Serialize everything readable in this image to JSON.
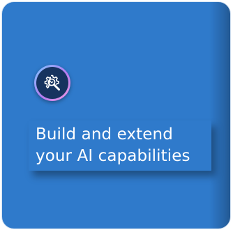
{
  "card": {
    "icon": "gear-wrench-search-icon",
    "title_lines": [
      "Build and extend",
      "your AI capabilities"
    ],
    "colors": {
      "card_background": "#2f7acb",
      "icon_badge_background": "#16335f",
      "text": "#ffffff"
    }
  }
}
